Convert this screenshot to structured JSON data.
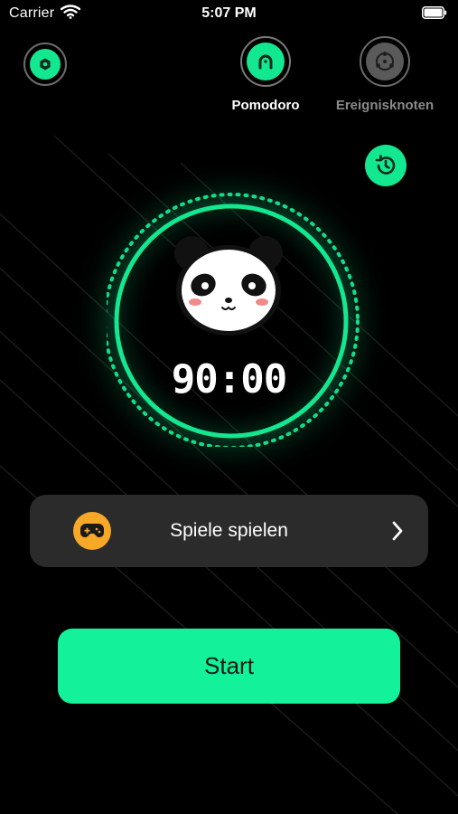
{
  "status_bar": {
    "carrier": "Carrier",
    "time": "5:07 PM"
  },
  "modes": [
    {
      "label": "Pomodoro",
      "icon": "pomodoro-icon",
      "active": true
    },
    {
      "label": "Ereignisknoten",
      "icon": "event-node-icon",
      "active": false
    }
  ],
  "timer": {
    "display": "90:00"
  },
  "games_card": {
    "label": "Spiele spielen",
    "icon": "gamepad-icon"
  },
  "actions": {
    "start_label": "Start"
  },
  "colors": {
    "accent": "#13e890",
    "card": "#2b2b2b",
    "gamepad": "#f6a826",
    "background": "#000000"
  }
}
